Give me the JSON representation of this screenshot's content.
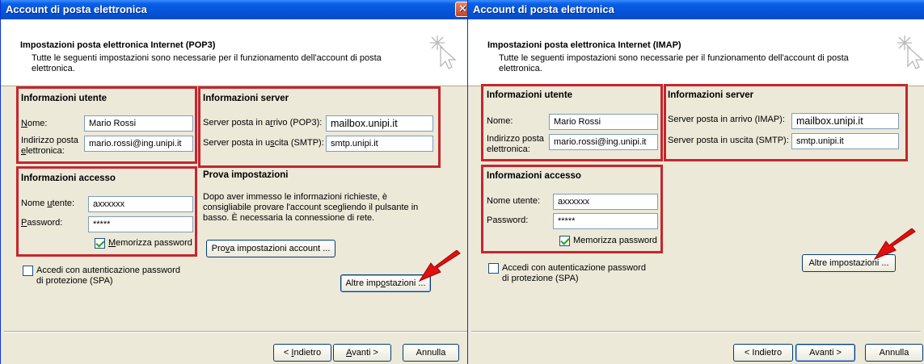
{
  "left": {
    "title": "Account di posta elettronica",
    "header_title": "Impostazioni posta elettronica Internet (POP3)",
    "header_desc": "Tutte le seguenti impostazioni sono necessarie per il funzionamento dell'account di posta elettronica.",
    "user_info_title": "Informazioni utente",
    "name_label": "Nome:",
    "name_value": "Mario Rossi",
    "email_label_1": "Indirizzo posta",
    "email_label_2": "elettronica:",
    "email_value": "mario.rossi@ing.unipi.it",
    "server_info_title": "Informazioni server",
    "incoming_label": "Server posta in arrivo (POP3):",
    "incoming_value": "mailbox.unipi.it",
    "outgoing_label": "Server posta in uscita (SMTP):",
    "outgoing_value": "smtp.unipi.it",
    "access_info_title": "Informazioni accesso",
    "username_label": "Nome utente:",
    "username_value": "axxxxxx",
    "password_label": "Password:",
    "password_value": "*****",
    "remember_label": "Memorizza password",
    "test_title": "Prova impostazioni",
    "test_desc": "Dopo aver immesso le informazioni richieste, è consigliabile provare l'account scegliendo il pulsante in basso. È necessaria la connessione di rete.",
    "test_button": "Prova impostazioni account ...",
    "spa_label_1": "Accedi con autenticazione password",
    "spa_label_2": "di protezione (SPA)",
    "more_settings": "Altre impostazioni ...",
    "back": "< Indietro",
    "next": "Avanti >",
    "cancel": "Annulla"
  },
  "right": {
    "title": "Account di posta elettronica",
    "header_title": "Impostazioni posta elettronica Internet (IMAP)",
    "header_desc": "Tutte le seguenti impostazioni sono necessarie per il funzionamento dell'account di posta elettronica.",
    "user_info_title": "Informazioni utente",
    "name_label": "Nome:",
    "name_value": "Mario Rossi",
    "email_label_1": "Indirizzo posta",
    "email_label_2": "elettronica:",
    "email_value": "mario.rossi@ing.unipi.it",
    "server_info_title": "Informazioni server",
    "incoming_label": "Server posta in arrivo (IMAP):",
    "incoming_value": "mailbox.unipi.it",
    "outgoing_label": "Server posta in uscita (SMTP):",
    "outgoing_value": "smtp.unipi.it",
    "access_info_title": "Informazioni accesso",
    "username_label": "Nome utente:",
    "username_value": "axxxxxx",
    "password_label": "Password:",
    "password_value": "*****",
    "remember_label": "Memorizza password",
    "spa_label_1": "Accedi con autenticazione password",
    "spa_label_2": "di protezione (SPA)",
    "more_settings": "Altre impostazioni ...",
    "back": "< Indietro",
    "next": "Avanti >",
    "cancel": "Annulla"
  },
  "colors": {
    "highlight_box": "#c6262e",
    "arrow": "#e01010",
    "titlebar": "#0354d7",
    "dialog_bg": "#ece9d8"
  }
}
